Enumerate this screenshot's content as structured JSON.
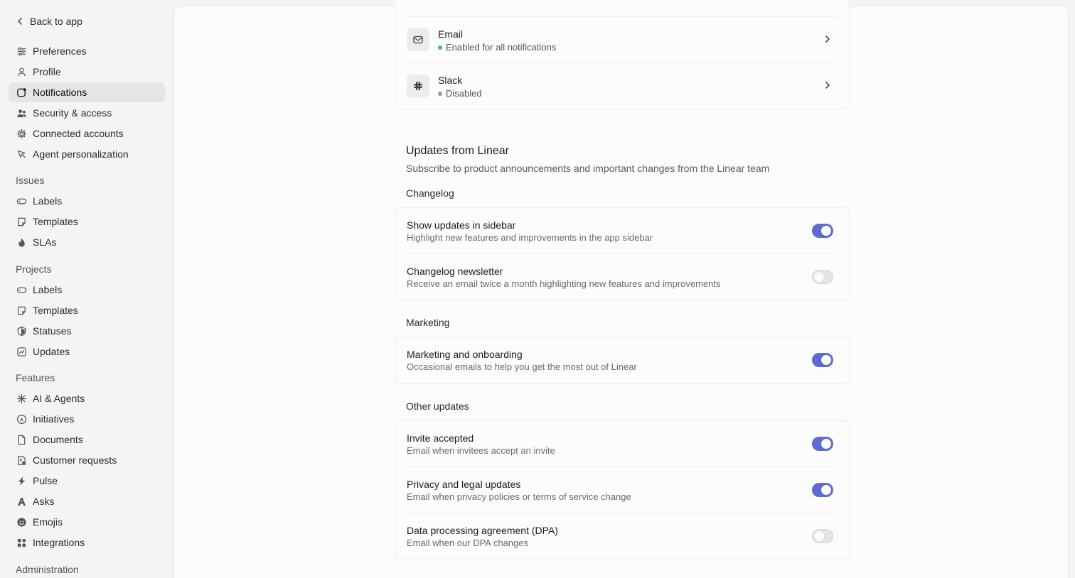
{
  "sidebar": {
    "back_label": "Back to app",
    "account": [
      {
        "label": "Preferences",
        "icon": "sliders-icon"
      },
      {
        "label": "Profile",
        "icon": "person-icon"
      },
      {
        "label": "Notifications",
        "icon": "bell-square-icon",
        "active": true
      },
      {
        "label": "Security & access",
        "icon": "people-icon"
      },
      {
        "label": "Connected accounts",
        "icon": "gear-icon"
      },
      {
        "label": "Agent personalization",
        "icon": "pen-icon"
      }
    ],
    "issues_label": "Issues",
    "issues": [
      {
        "label": "Labels",
        "icon": "tag-icon"
      },
      {
        "label": "Templates",
        "icon": "note-icon"
      },
      {
        "label": "SLAs",
        "icon": "flame-icon"
      }
    ],
    "projects_label": "Projects",
    "projects": [
      {
        "label": "Labels",
        "icon": "tag-icon"
      },
      {
        "label": "Templates",
        "icon": "note-icon"
      },
      {
        "label": "Statuses",
        "icon": "shield-icon"
      },
      {
        "label": "Updates",
        "icon": "chart-icon"
      }
    ],
    "features_label": "Features",
    "features": [
      {
        "label": "AI & Agents",
        "icon": "sparkle-icon"
      },
      {
        "label": "Initiatives",
        "icon": "compass-icon"
      },
      {
        "label": "Documents",
        "icon": "document-icon"
      },
      {
        "label": "Customer requests",
        "icon": "list-icon"
      },
      {
        "label": "Pulse",
        "icon": "bolt-icon"
      },
      {
        "label": "Asks",
        "icon": "asks-icon"
      },
      {
        "label": "Emojis",
        "icon": "smile-icon"
      },
      {
        "label": "Integrations",
        "icon": "grid-icon"
      }
    ],
    "administration_label": "Administration"
  },
  "channels": [
    {
      "title": "Email",
      "status": "Enabled for all notifications",
      "status_color": "#4cb782",
      "icon": "mail-icon"
    },
    {
      "title": "Slack",
      "status": "Disabled",
      "status_color": "#9a9a9a",
      "icon": "slack-icon"
    }
  ],
  "updates": {
    "title": "Updates from Linear",
    "description": "Subscribe to product announcements and important changes from the Linear team",
    "changelog_label": "Changelog",
    "changelog": [
      {
        "title": "Show updates in sidebar",
        "sub": "Highlight new features and improvements in the app sidebar",
        "on": true
      },
      {
        "title": "Changelog newsletter",
        "sub": "Receive an email twice a month highlighting new features and improvements",
        "on": false
      }
    ],
    "marketing_label": "Marketing",
    "marketing": [
      {
        "title": "Marketing and onboarding",
        "sub": "Occasional emails to help you get the most out of Linear",
        "on": true
      }
    ],
    "other_label": "Other updates",
    "other": [
      {
        "title": "Invite accepted",
        "sub": "Email when invitees accept an invite",
        "on": true
      },
      {
        "title": "Privacy and legal updates",
        "sub": "Email when privacy policies or terms of service change",
        "on": true
      },
      {
        "title": "Data processing agreement (DPA)",
        "sub": "Email when our DPA changes",
        "on": false
      }
    ]
  },
  "colors": {
    "accent": "#5e6ad2"
  }
}
